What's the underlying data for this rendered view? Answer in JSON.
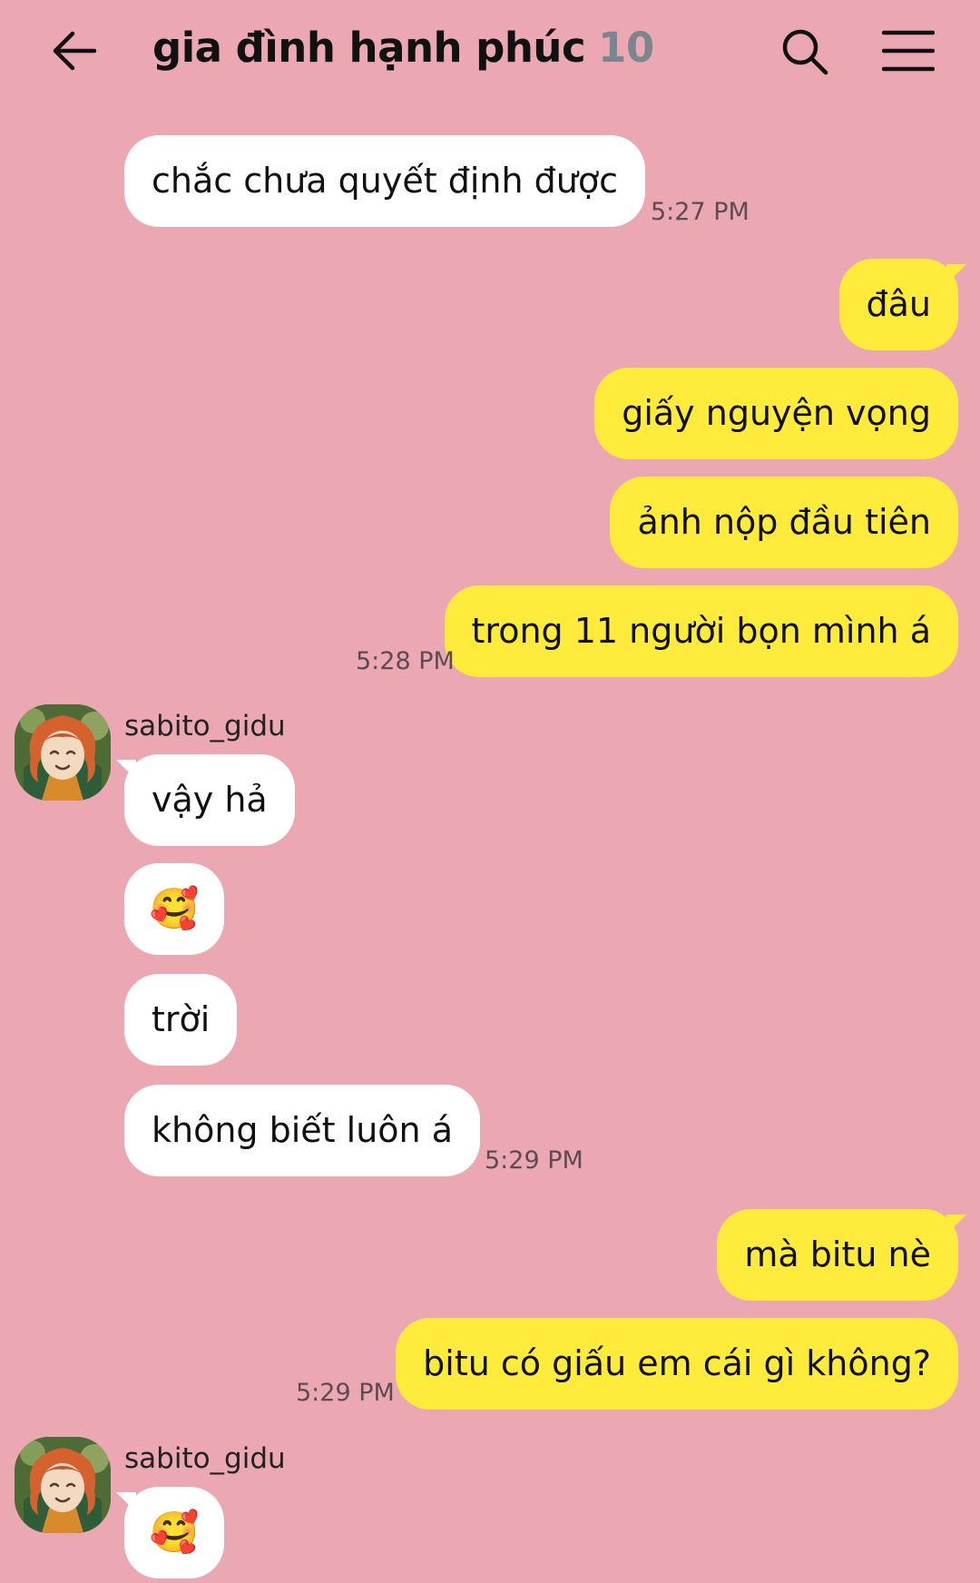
{
  "header": {
    "title": "gia đình hạnh phúc",
    "member_count": "10"
  },
  "messages": {
    "m1": {
      "text": "chắc chưa quyết định được",
      "time": "5:27 PM"
    },
    "m2": {
      "text": "đâu"
    },
    "m3": {
      "text": "giấy nguyện vọng"
    },
    "m4": {
      "text": "ảnh nộp đầu tiên"
    },
    "m5": {
      "text": "trong 11 người bọn mình á",
      "time": "5:28 PM"
    },
    "m6": {
      "sender": "sabito_gidu",
      "text": "vậy hả"
    },
    "m7": {
      "text": "🥰"
    },
    "m8": {
      "text": "trời"
    },
    "m9": {
      "text": "không biết luôn á",
      "time": "5:29 PM"
    },
    "m10": {
      "text": "mà bitu nè"
    },
    "m11": {
      "text": "bitu có giấu em cái gì không?",
      "time": "5:29 PM"
    },
    "m12": {
      "sender": "sabito_gidu",
      "text": "🥰"
    }
  },
  "icons": {
    "back": "arrow-left-icon",
    "search": "search-icon",
    "menu": "hamburger-menu-icon"
  },
  "colors": {
    "background": "#eba8b2",
    "outgoing_bubble": "#ffeb3b",
    "incoming_bubble": "#ffffff",
    "count": "#7b8590"
  }
}
